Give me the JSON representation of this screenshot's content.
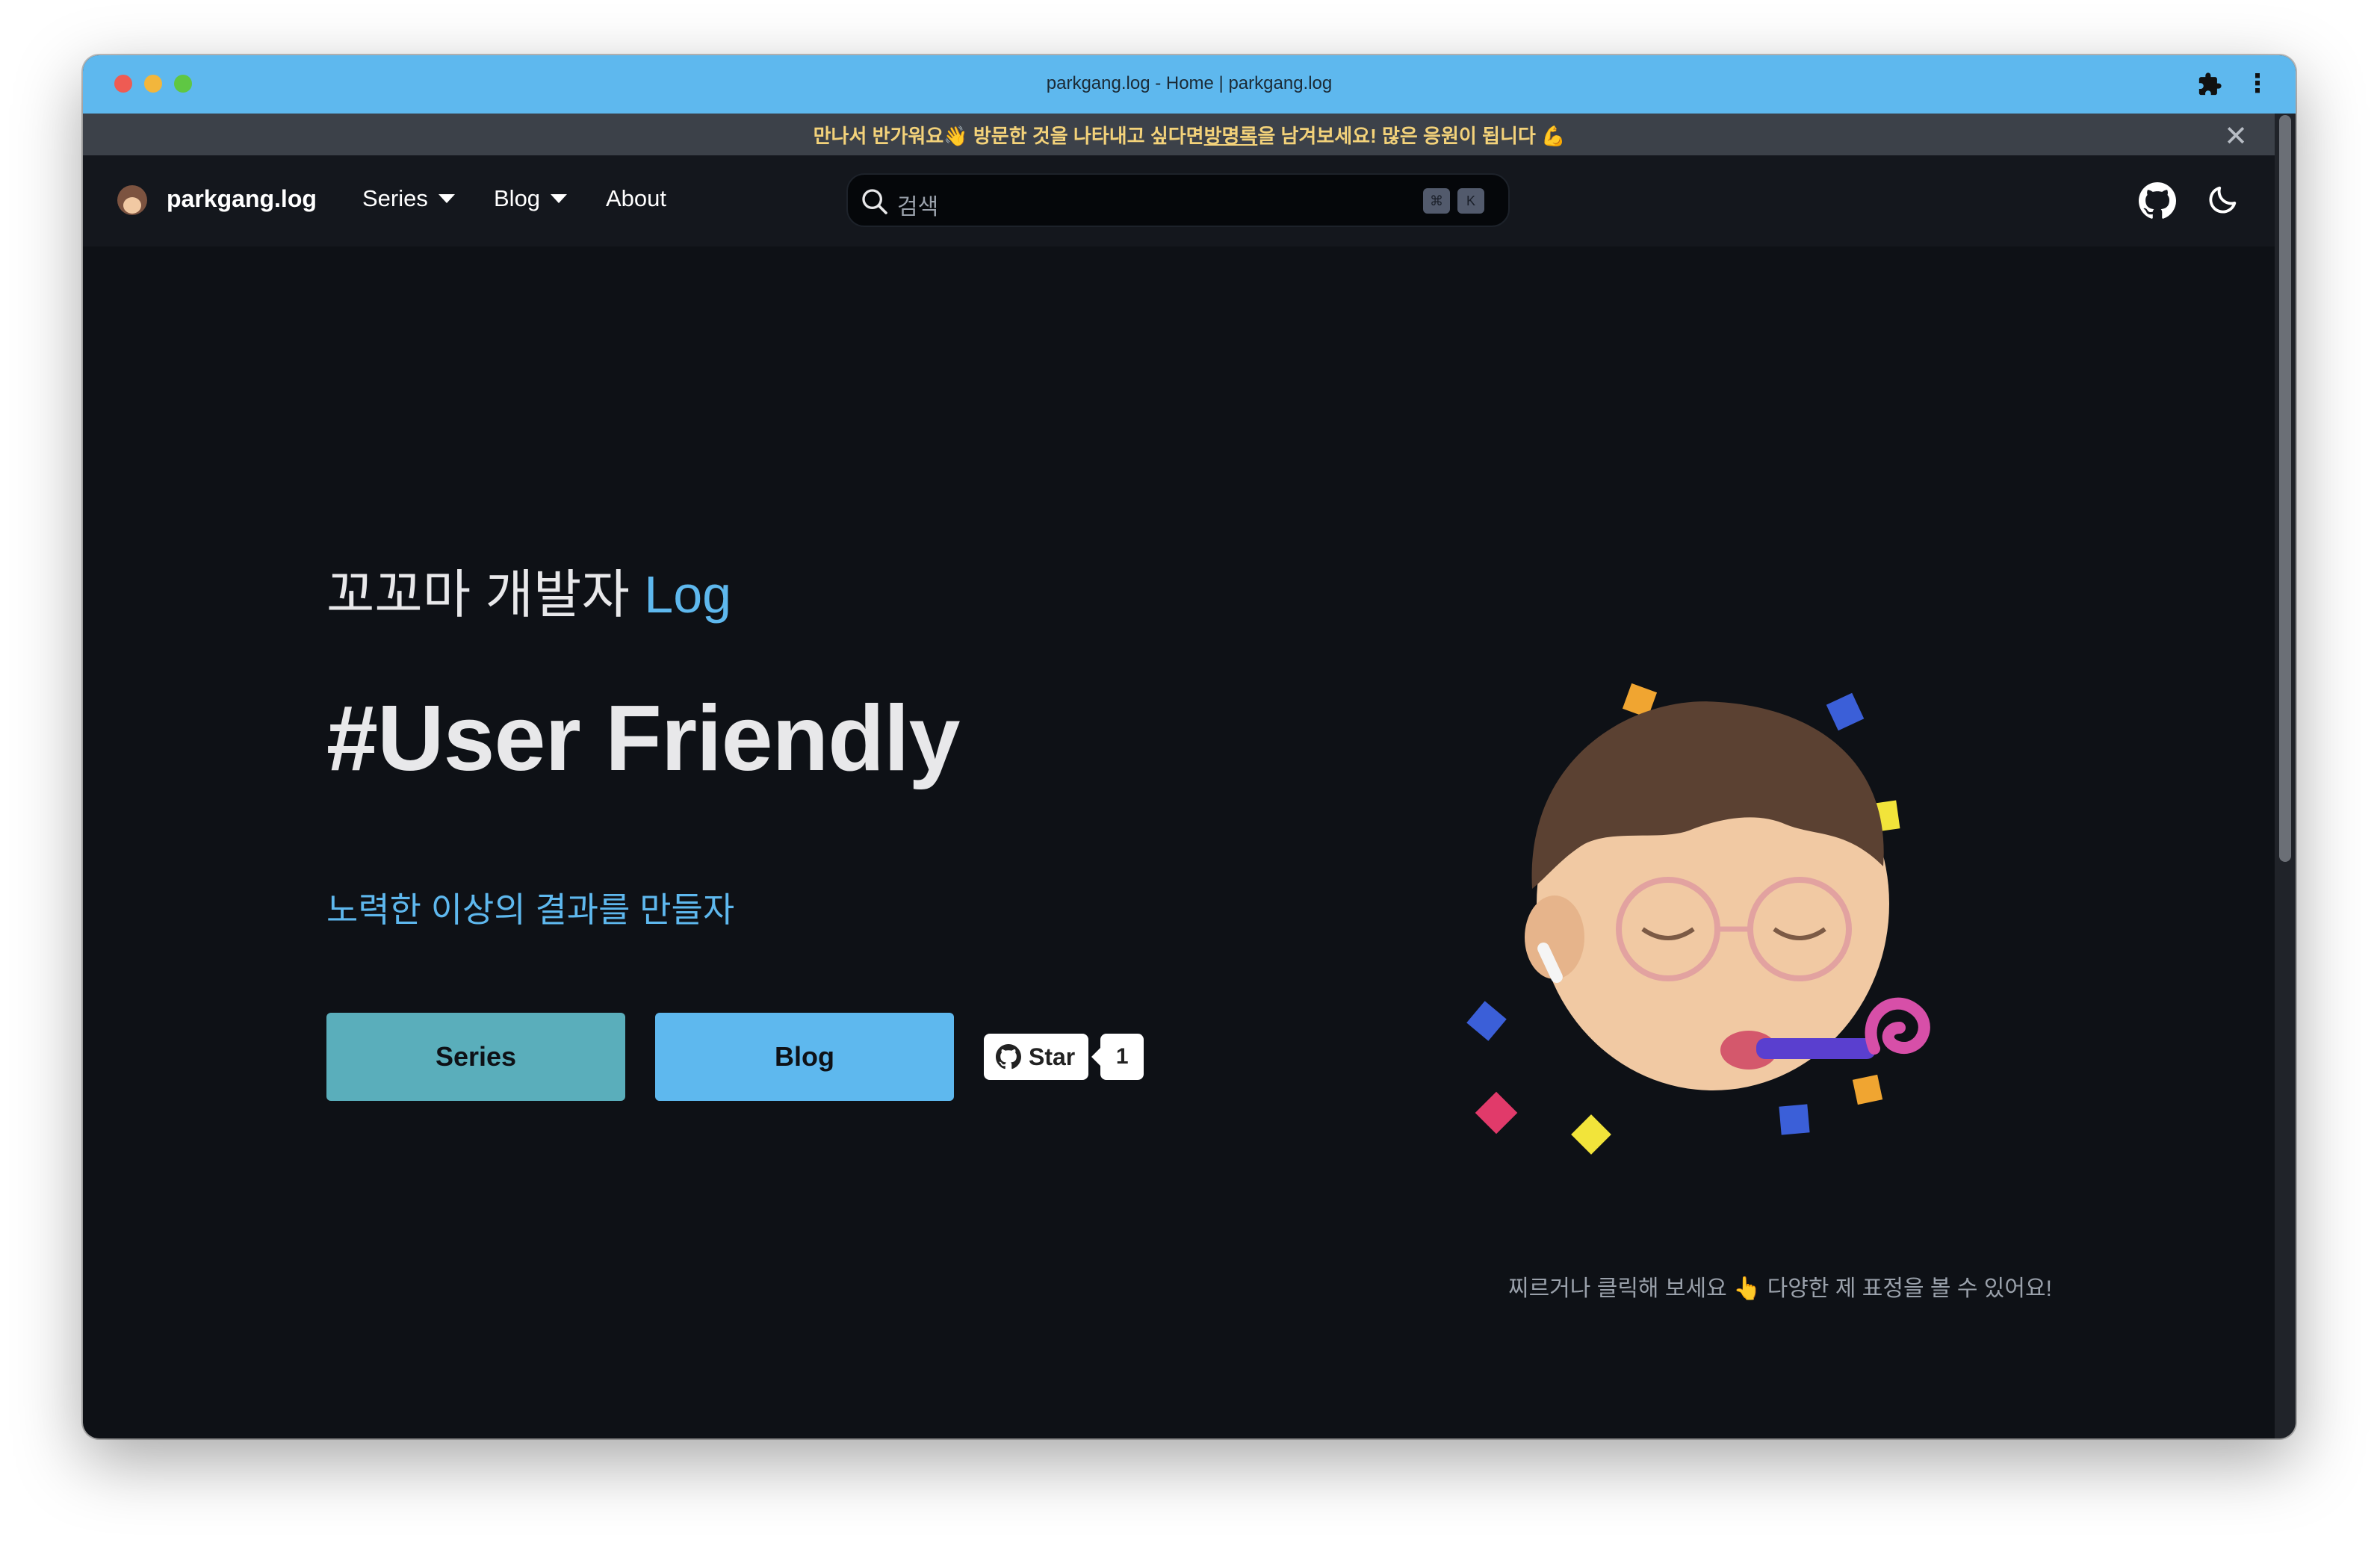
{
  "window": {
    "title": "parkgang.log - Home | parkgang.log",
    "extension_icon": "puzzle-icon",
    "menu_icon": "kebab-menu-icon"
  },
  "banner": {
    "text_before": "만나서 반가워요👋 방문한 것을 나타내고 싶다면 ",
    "link": "방명록",
    "text_after": "을 남겨보세요! 많은 응원이 됩니다 💪",
    "close": "✕"
  },
  "nav": {
    "brand": "parkgang.log",
    "items": [
      {
        "label": "Series",
        "dropdown": true
      },
      {
        "label": "Blog",
        "dropdown": true
      },
      {
        "label": "About",
        "dropdown": false
      }
    ],
    "search": {
      "placeholder": "검색",
      "shortcut_keys": [
        "⌘",
        "K"
      ]
    },
    "icons": [
      "github-icon",
      "moon-icon"
    ]
  },
  "hero": {
    "subtitle_prefix": "꼬꼬마 개발자 ",
    "subtitle_accent": "Log",
    "headline": "#User Friendly",
    "tagline": "노력한 이상의 결과를 만들자",
    "buttons": {
      "series": "Series",
      "blog": "Blog"
    },
    "github_star": {
      "label": "Star",
      "count": "1"
    },
    "caption": "찌르거나 클릭해 보세요 👆 다양한 제 표정을 볼 수 있어요!"
  },
  "colors": {
    "titlebar": "#5eb8ee",
    "banner_bg": "#3c4149",
    "banner_text": "#f3d27a",
    "nav_bg": "#14171d",
    "page_bg": "#0e1116",
    "accent": "#5eb8ee",
    "series_button": "#5aaebb",
    "blog_button": "#5eb8ee"
  }
}
